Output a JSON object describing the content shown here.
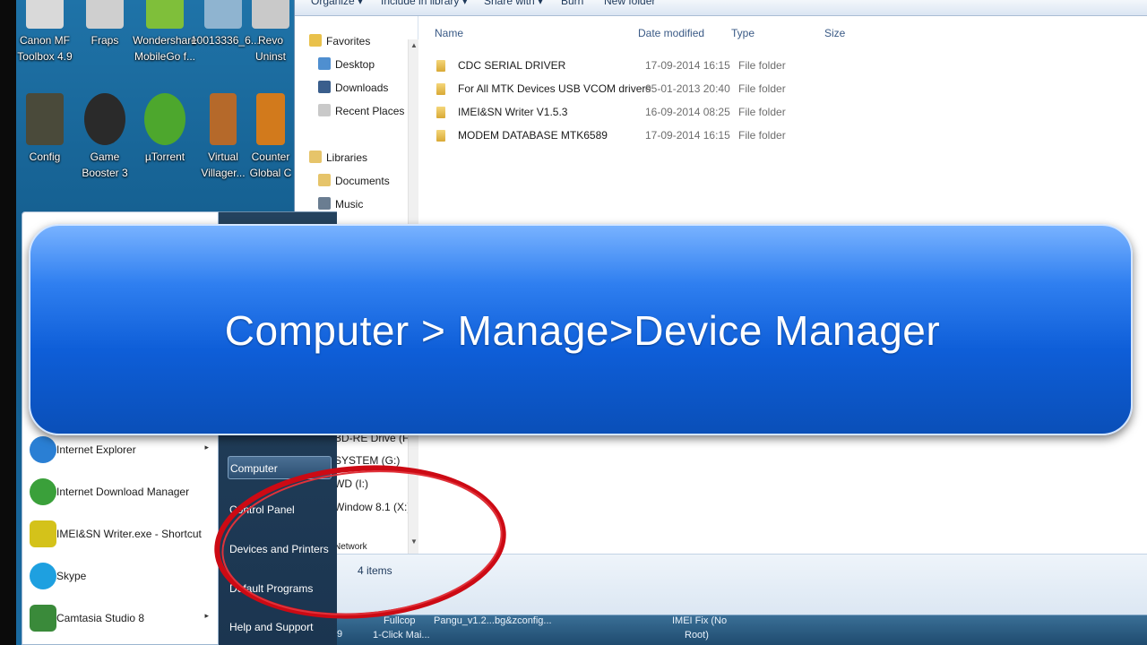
{
  "desktop": {
    "icons": [
      {
        "name": "canon-mf-toolbox",
        "label": "Canon MF\nToolbox 4.9",
        "color": "#d9d9d9"
      },
      {
        "name": "fraps",
        "label": "Fraps",
        "color": "#cfcfcf"
      },
      {
        "name": "wondershare-mobilego",
        "label": "Wondershare\nMobileGo f...",
        "color": "#7fbf3a"
      },
      {
        "name": "image-file",
        "label": "10013336_6...",
        "color": "#8fb4d0"
      },
      {
        "name": "revo-uninstaller",
        "label": "Revo\nUninst",
        "color": "#c9c9c9"
      },
      {
        "name": "config",
        "label": "Config",
        "color": "#4a4a3a"
      },
      {
        "name": "game-booster",
        "label": "Game\nBooster 3",
        "color": "#2a2a2a"
      },
      {
        "name": "utorrent",
        "label": "µTorrent",
        "color": "#4da72d"
      },
      {
        "name": "virtual-villagers",
        "label": "Virtual\nVillager...",
        "color": "#b5692a"
      },
      {
        "name": "counter-strike",
        "label": "Counter\nGlobal C",
        "color": "#d27a1c"
      }
    ]
  },
  "explorer": {
    "toolbar": {
      "organize": "Organize ▾",
      "include": "Include in library ▾",
      "share": "Share with ▾",
      "burn": "Burn",
      "new_folder": "New folder"
    },
    "nav": {
      "favorites": "Favorites",
      "desktop": "Desktop",
      "downloads": "Downloads",
      "recent": "Recent Places",
      "libraries": "Libraries",
      "documents": "Documents",
      "music": "Music",
      "drive_f": "BD-RE Drive (F:) (",
      "drive_g": "SYSTEM (G:)",
      "drive_i": "WD (I:)",
      "drive_x": "Window 8.1  (X:)",
      "network": "Network"
    },
    "columns": {
      "name": "Name",
      "date": "Date modified",
      "type": "Type",
      "size": "Size"
    },
    "files": [
      {
        "name": "CDC SERIAL DRIVER",
        "date": "17-09-2014 16:15",
        "type": "File folder"
      },
      {
        "name": "For All MTK Devices  USB VCOM drivers",
        "date": "05-01-2013 20:40",
        "type": "File folder"
      },
      {
        "name": "IMEI&SN Writer V1.5.3",
        "date": "16-09-2014 08:25",
        "type": "File folder"
      },
      {
        "name": "MODEM DATABASE MTK6589",
        "date": "17-09-2014 16:15",
        "type": "File folder"
      }
    ],
    "status": "4 items"
  },
  "taskbar": {
    "items": [
      "9",
      "Fullcop",
      "1-Click Mai...",
      "Pangu_v1.2....",
      "bg&zconfig...",
      "IMEI Fix (No",
      "Root)"
    ]
  },
  "start_menu": {
    "programs": [
      {
        "label": "Internet Explorer",
        "arrow": "▸",
        "color": "#2a7fd4"
      },
      {
        "label": "Internet Download Manager",
        "arrow": "",
        "color": "#3aa03a"
      },
      {
        "label": "IMEI&SN Writer.exe - Shortcut",
        "arrow": "",
        "color": "#d4c21a"
      },
      {
        "label": "Skype",
        "arrow": "",
        "color": "#1ea0e0"
      },
      {
        "label": "Camtasia Studio 8",
        "arrow": "▸",
        "color": "#3a8a3a"
      }
    ],
    "right": {
      "computer": "Computer",
      "control_panel": "Control Panel",
      "devices": "Devices and Printers",
      "default_programs": "Default Programs",
      "help": "Help and Support"
    }
  },
  "banner": {
    "text": "Computer > Manage>Device Manager"
  },
  "colors": {
    "banner_top": "#78b2ff",
    "banner_bottom": "#0a4fb8",
    "annotation": "#cc0a14"
  }
}
